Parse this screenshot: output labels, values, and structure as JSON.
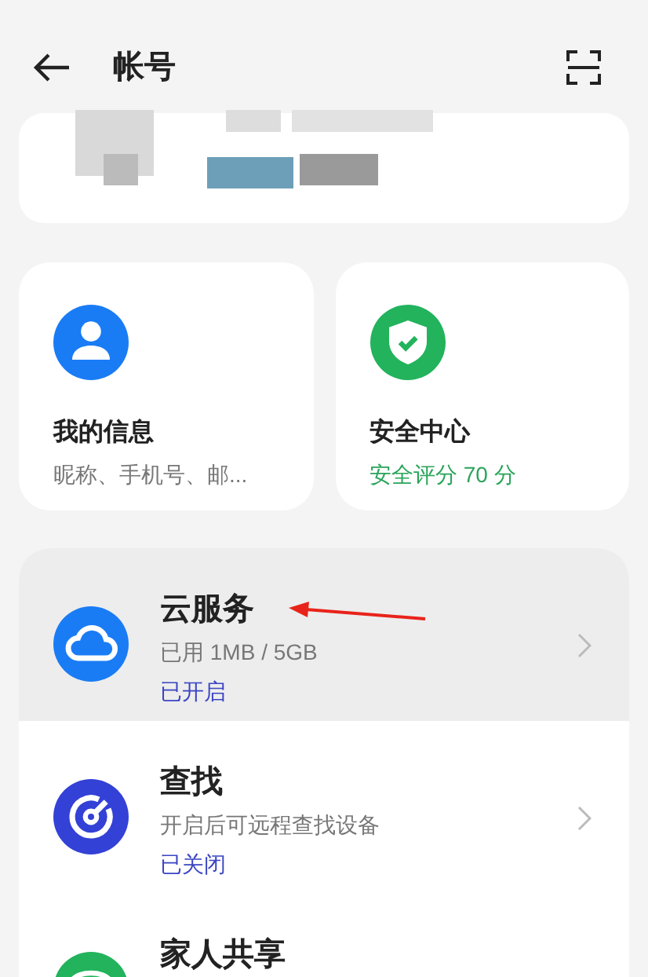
{
  "header": {
    "title": "帐号"
  },
  "cards": [
    {
      "kind": "profile",
      "title": "我的信息",
      "subtitle": "昵称、手机号、邮..."
    },
    {
      "kind": "security",
      "title": "安全中心",
      "subtitle": "安全评分 70 分"
    }
  ],
  "services": [
    {
      "kind": "cloud",
      "title": "云服务",
      "detail": "已用 1MB / 5GB",
      "status": "已开启",
      "pressed": true
    },
    {
      "kind": "find",
      "title": "查找",
      "detail": "开启后可远程查找设备",
      "status": "已关闭",
      "pressed": false
    },
    {
      "kind": "family",
      "title": "家人共享",
      "pressed": false
    }
  ],
  "annotation": {
    "kind": "arrow"
  }
}
